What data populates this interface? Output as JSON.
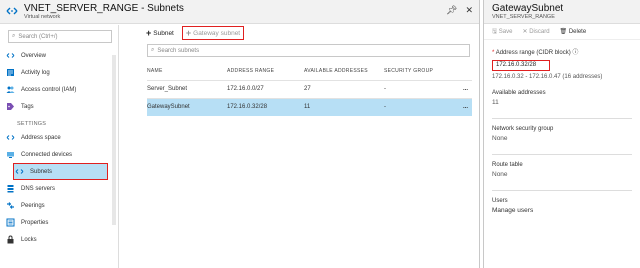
{
  "left_blade": {
    "title": "VNET_SERVER_RANGE - Subnets",
    "subtitle": "Virtual network",
    "actions": [
      "pin-icon",
      "close-icon"
    ]
  },
  "menu": {
    "search_placeholder": "Search (Ctrl+/)",
    "top_items": [
      {
        "label": "Overview",
        "icon": "overview-icon"
      },
      {
        "label": "Activity log",
        "icon": "activity-log-icon"
      },
      {
        "label": "Access control (IAM)",
        "icon": "iam-icon"
      },
      {
        "label": "Tags",
        "icon": "tag-icon"
      }
    ],
    "section_label": "SETTINGS",
    "settings_items": [
      {
        "label": "Address space",
        "icon": "address-space-icon"
      },
      {
        "label": "Connected devices",
        "icon": "devices-icon"
      },
      {
        "label": "Subnets",
        "icon": "subnets-icon"
      },
      {
        "label": "DNS servers",
        "icon": "dns-icon"
      },
      {
        "label": "Peerings",
        "icon": "peerings-icon"
      },
      {
        "label": "Properties",
        "icon": "properties-icon"
      },
      {
        "label": "Locks",
        "icon": "lock-icon"
      }
    ]
  },
  "toolbar": {
    "subnet_label": "Subnet",
    "gateway_label": "Gateway subnet"
  },
  "subnets": {
    "search_placeholder": "Search subnets",
    "columns": [
      "NAME",
      "ADDRESS RANGE",
      "AVAILABLE ADDRESSES",
      "SECURITY GROUP"
    ],
    "rows": [
      {
        "name": "Server_Subnet",
        "range": "172.16.0.0/27",
        "available": "27",
        "group": "-",
        "more": "..."
      },
      {
        "name": "GatewaySubnet",
        "range": "172.16.0.32/28",
        "available": "11",
        "group": "-",
        "more": "..."
      }
    ]
  },
  "right_blade": {
    "title": "GatewaySubnet",
    "subtitle": "VNET_SERVER_RANGE",
    "save_label": "Save",
    "discard_label": "Discard",
    "delete_label": "Delete",
    "address_label": "Address range (CIDR block)",
    "address_value": "172.16.0.32/28",
    "address_hint": "172.16.0.32 - 172.16.0.47 (16 addresses)",
    "available_label": "Available addresses",
    "available_value": "11",
    "nsg_label": "Network security group",
    "nsg_value": "None",
    "route_label": "Route table",
    "route_value": "None",
    "users_label": "Users",
    "users_value": "Manage users"
  },
  "colors": {
    "accent": "#0072c6",
    "selection": "#b7dff5",
    "highlight": "#e02020"
  }
}
